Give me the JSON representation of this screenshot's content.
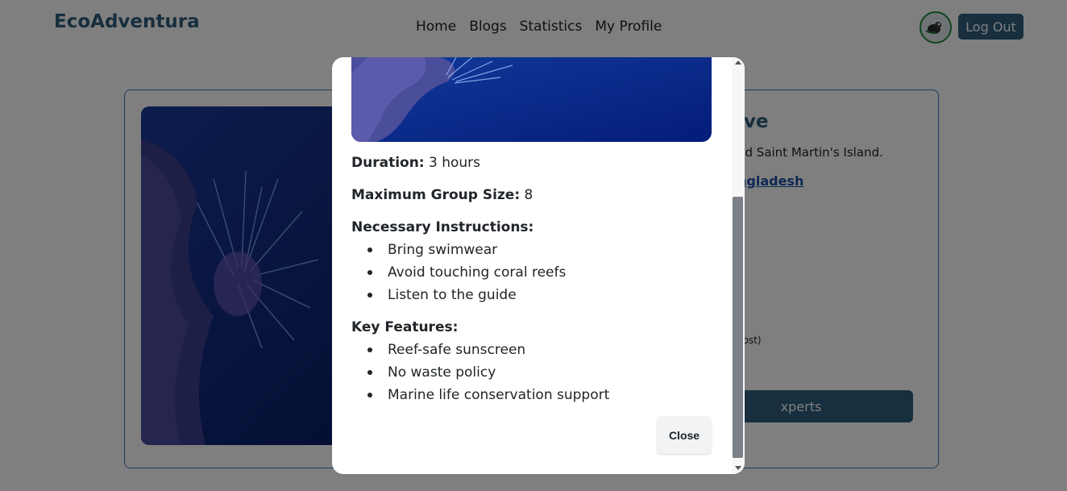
{
  "header": {
    "brand": "EcoAdventura",
    "nav": [
      "Home",
      "Blogs",
      "Statistics",
      "My Profile"
    ],
    "logout_label": "Log Out",
    "avatar_icon": "user-avatar-icon"
  },
  "background_card": {
    "title_partial": "ive",
    "description_partial": "nd Saint Martin's Island.",
    "location_partial": "ngladesh",
    "cost_partial": "cost)",
    "button_partial": "xperts"
  },
  "modal": {
    "duration_label": "Duration:",
    "duration_value": "3 hours",
    "group_size_label": "Maximum Group Size:",
    "group_size_value": "8",
    "instructions_label": "Necessary Instructions:",
    "instructions": [
      "Bring swimwear",
      "Avoid touching coral reefs",
      "Listen to the guide"
    ],
    "features_label": "Key Features:",
    "features": [
      "Reef-safe sunscreen",
      "No waste policy",
      "Marine life conservation support"
    ],
    "close_label": "Close"
  },
  "colors": {
    "brand": "#2c5d7c",
    "button": "#2f5f7f",
    "overlay": "rgba(0,0,0,0.5)"
  }
}
